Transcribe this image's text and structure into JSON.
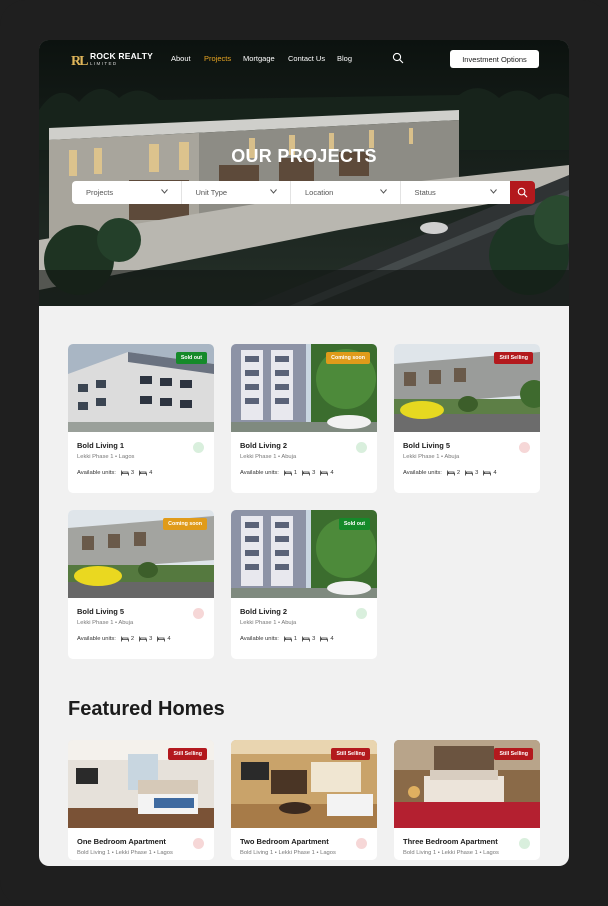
{
  "nav": {
    "logo_name": "ROCK REALTY",
    "logo_sub": "LIMITED",
    "logo_mark": "RL",
    "items": [
      {
        "label": "About",
        "active": false
      },
      {
        "label": "Projects",
        "active": true
      },
      {
        "label": "Mortgage",
        "active": false
      },
      {
        "label": "Contact Us",
        "active": false
      },
      {
        "label": "Blog",
        "active": false
      }
    ],
    "cta": "Investment Options",
    "accent": "#e9a622"
  },
  "hero": {
    "title": "OUR PROJECTS",
    "filters": [
      "Projects",
      "Unit Type",
      "Location",
      "Status"
    ],
    "search_color": "#b3191d"
  },
  "projects": [
    {
      "title": "Bold Living 1",
      "location": "Lekki Phase 1 • Lagos",
      "status": "Sold out",
      "status_color": "green",
      "type_icon": "building-icon",
      "units_label": "Available units:",
      "units": [
        "3",
        "4"
      ]
    },
    {
      "title": "Bold Living 2",
      "location": "Lekki Phase 1 • Abuja",
      "status": "Coming soon",
      "status_color": "orange",
      "type_icon": "building-icon",
      "units_label": "Available units:",
      "units": [
        "1",
        "3",
        "4"
      ]
    },
    {
      "title": "Bold Living 5",
      "location": "Lekki Phase 1 • Abuja",
      "status": "Still Selling",
      "status_color": "red",
      "type_icon": "house-icon",
      "units_label": "Available units:",
      "units": [
        "2",
        "3",
        "4"
      ]
    },
    {
      "title": "Bold Living 5",
      "location": "Lekki Phase 1 • Abuja",
      "status": "Coming soon",
      "status_color": "orange",
      "type_icon": "house-icon",
      "units_label": "Available units:",
      "units": [
        "2",
        "3",
        "4"
      ]
    },
    {
      "title": "Bold Living 2",
      "location": "Lekki Phase 1 • Abuja",
      "status": "Sold out",
      "status_color": "green",
      "type_icon": "building-icon",
      "units_label": "Available units:",
      "units": [
        "1",
        "3",
        "4"
      ]
    }
  ],
  "featured": {
    "title": "Featured Homes",
    "homes": [
      {
        "title": "One Bedroom Apartment",
        "location": "Bold Living 1 • Lekki Phase 1 • Lagos",
        "status": "Still Selling"
      },
      {
        "title": "Two Bedroom Apartment",
        "location": "Bold Living 1 • Lekki Phase 1 • Lagos",
        "status": "Still Selling"
      },
      {
        "title": "Three Bedroom Apartment",
        "location": "Bold Living 1 • Lekki Phase 1 • Lagos",
        "status": "Still Selling"
      }
    ]
  }
}
